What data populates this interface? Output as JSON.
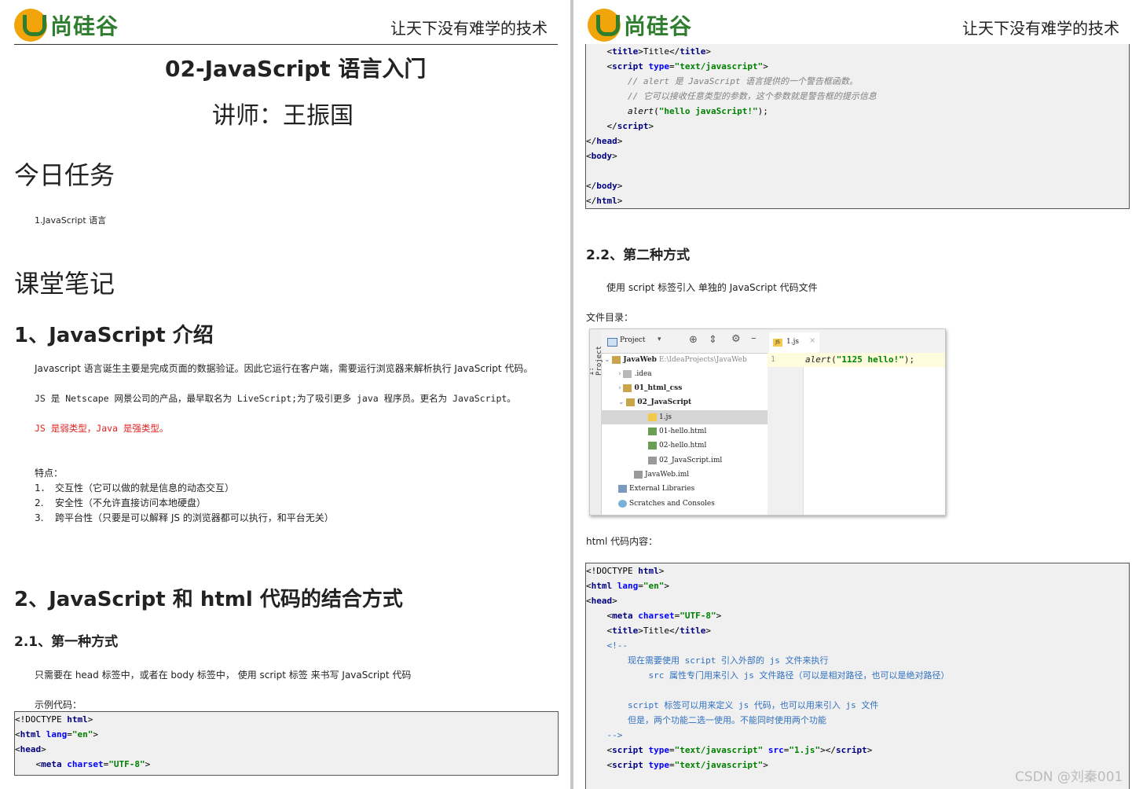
{
  "header": {
    "logo_text": "尚硅谷",
    "slogan": "让天下没有难学的技术"
  },
  "page1": {
    "title": "02-JavaScript 语言入门",
    "subtitle": "讲师：王振国",
    "today_task_heading": "今日任务",
    "today_task_item": "1.JavaScript 语言",
    "notes_heading": "课堂笔记",
    "sec1_heading": "1、JavaScript 介绍",
    "sec1_p1": "Javascript 语言诞生主要是完成页面的数据验证。因此它运行在客户端，需要运行浏览器来解析执行 JavaScript 代码。",
    "sec1_p2": "JS 是 Netscape 网景公司的产品，最早取名为 LiveScript;为了吸引更多 java 程序员。更名为 JavaScript。",
    "sec1_p3": "JS 是弱类型，Java 是强类型。",
    "features_label": "特点：",
    "features": [
      {
        "num": "1．",
        "text": "交互性（它可以做的就是信息的动态交互）"
      },
      {
        "num": "2.",
        "text": "安全性（不允许直接访问本地硬盘）"
      },
      {
        "num": "3.",
        "text": "跨平台性（只要是可以解释 JS 的浏览器都可以执行，和平台无关）"
      }
    ],
    "sec2_heading": "2、JavaScript 和 html 代码的结合方式",
    "sec21_heading": "2.1、第一种方式",
    "sec21_p": "只需要在 head 标签中，或者在 body 标签中， 使用 script 标签 来书写 JavaScript 代码",
    "example_label": "示例代码：",
    "code1": {
      "doctype": "<!DOCTYPE ",
      "html_kw": "html",
      "html_open": "html",
      "lang_attr": "lang",
      "lang_val": "\"en\"",
      "head": "head",
      "meta": "meta",
      "charset_attr": "charset",
      "charset_val": "\"UTF-8\""
    }
  },
  "page2": {
    "code_top": {
      "title_text": "Title",
      "script_type_attr": "type",
      "script_type_val": "\"text/javascript\"",
      "comment1": "// alert 是 JavaScript 语言提供的一个警告框函数。",
      "comment2": "// 它可以接收任意类型的参数，这个参数就是警告框的提示信息",
      "alert_fn": "alert",
      "alert_arg": "\"hello javaScript!\"",
      "alert_end": ");"
    },
    "sec22_heading": "2.2、第二种方式",
    "sec22_p": "使用 script 标签引入 单独的 JavaScript 代码文件",
    "dir_label": "文件目录：",
    "ide": {
      "side_label": "1: Project",
      "project_label": "Project",
      "tab_label": "1.js",
      "tree": [
        {
          "label": "JavaWeb",
          "suffix": "E:\\IdeaProjects\\JavaWeb"
        },
        {
          "label": ".idea"
        },
        {
          "label": "01_html_css"
        },
        {
          "label": "02_JavaScript"
        },
        {
          "label": "1.js"
        },
        {
          "label": "01-hello.html"
        },
        {
          "label": "02-hello.html"
        },
        {
          "label": "02_JavaScript.iml"
        },
        {
          "label": "JavaWeb.iml"
        },
        {
          "label": "External Libraries"
        },
        {
          "label": "Scratches and Consoles"
        }
      ],
      "line_number": "1",
      "code_fn": "alert",
      "code_arg": "\"1125 hello!\"",
      "code_end": ");"
    },
    "html_label": "html 代码内容：",
    "code2": {
      "comment_open": "<!--",
      "c1": "现在需要使用 script 引入外部的 js 文件来执行",
      "c2": "src 属性专门用来引入 js 文件路径（可以是相对路径，也可以是绝对路径）",
      "c3": "script 标签可以用来定义 js 代码，也可以用来引入 js 文件",
      "c4": "但是，两个功能二选一使用。不能同时使用两个功能",
      "comment_close": "-->",
      "src_attr": "src",
      "src_val": "\"1.js\""
    },
    "watermark": "CSDN @刘秦001"
  },
  "colors": {
    "keyword": "#000080",
    "attribute": "#0000ff",
    "string": "#008000",
    "red_text": "#e02020",
    "logo_green": "#2f7d2f",
    "logo_orange": "#f1a50a",
    "code_bg": "#f0f0f0"
  }
}
